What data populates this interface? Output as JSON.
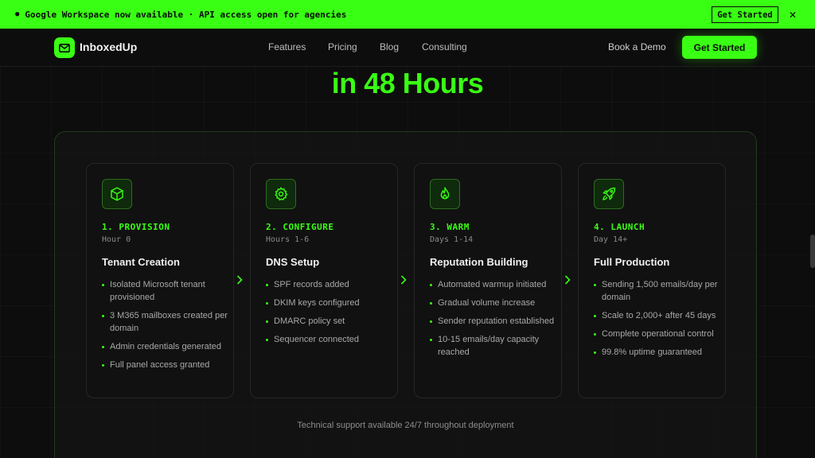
{
  "announcement": {
    "text": "Google Workspace now available · API access open for agencies",
    "cta": "Get Started",
    "close": "✕"
  },
  "nav": {
    "brand": "InboxedUp",
    "links": [
      "Features",
      "Pricing",
      "Blog",
      "Consulting"
    ],
    "demo": "Book a Demo",
    "cta": "Get Started"
  },
  "hero": {
    "title": "in 48 Hours"
  },
  "steps": [
    {
      "icon": "cube-icon",
      "step": "1. PROVISION",
      "time": "Hour 0",
      "title": "Tenant Creation",
      "items": [
        "Isolated Microsoft tenant provisioned",
        "3 M365 mailboxes created per domain",
        "Admin credentials generated",
        "Full panel access granted"
      ]
    },
    {
      "icon": "gear-icon",
      "step": "2. CONFIGURE",
      "time": "Hours 1-6",
      "title": "DNS Setup",
      "items": [
        "SPF records added",
        "DKIM keys configured",
        "DMARC policy set",
        "Sequencer connected"
      ]
    },
    {
      "icon": "flame-icon",
      "step": "3. WARM",
      "time": "Days 1-14",
      "title": "Reputation Building",
      "items": [
        "Automated warmup initiated",
        "Gradual volume increase",
        "Sender reputation established",
        "10-15 emails/day capacity reached"
      ]
    },
    {
      "icon": "rocket-icon",
      "step": "4. LAUNCH",
      "time": "Day 14+",
      "title": "Full Production",
      "items": [
        "Sending 1,500 emails/day per domain",
        "Scale to 2,000+ after 45 days",
        "Complete operational control",
        "99.8% uptime guaranteed"
      ]
    }
  ],
  "footer_note": "Technical support available 24/7 throughout deployment",
  "colors": {
    "accent": "#39ff14",
    "background": "#0d0d0d"
  }
}
